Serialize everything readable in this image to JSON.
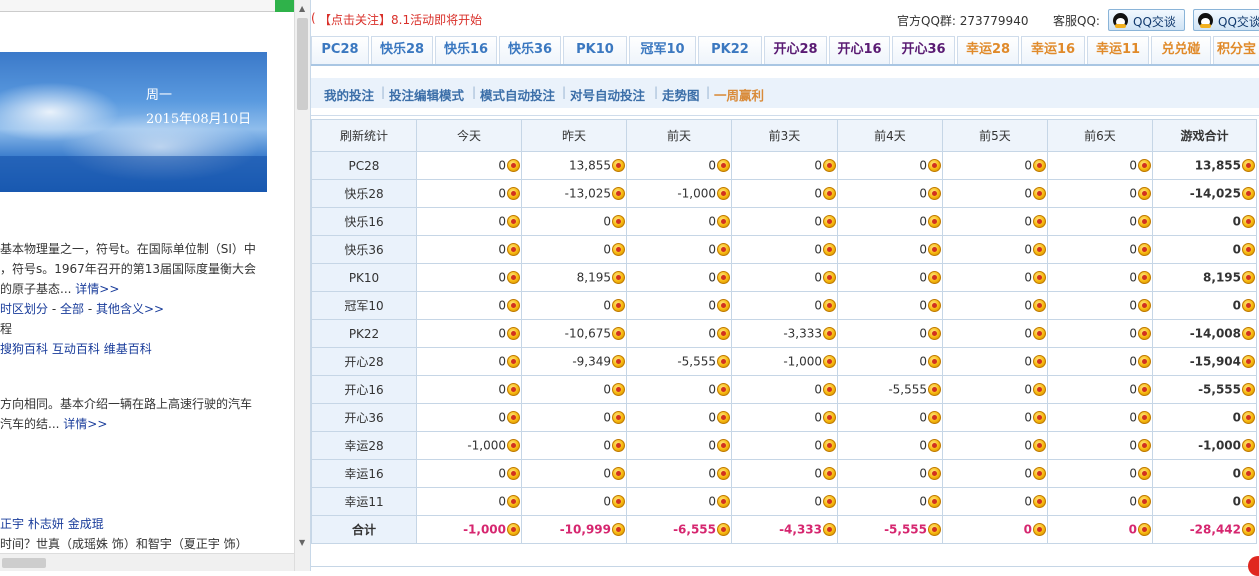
{
  "left_pane": {
    "weekday": "周一",
    "date": "2015年08月10日",
    "lines": [
      {
        "parts": [
          {
            "t": "基本物理量之一，符号t。在国际单位制（SI）中",
            "c": ""
          }
        ]
      },
      {
        "parts": [
          {
            "t": "，符号s。1967年召开的第13届国际度量衡大会",
            "c": ""
          }
        ]
      },
      {
        "parts": [
          {
            "t": "的原子基态...",
            "c": ""
          },
          {
            "t": " 详情>>",
            "c": "lnk"
          }
        ]
      },
      {
        "parts": [
          {
            "t": "时区划分",
            "c": "lnk"
          },
          {
            "t": " - ",
            "c": ""
          },
          {
            "t": "全部",
            "c": "lnk"
          },
          {
            "t": " - ",
            "c": ""
          },
          {
            "t": "其他含义>>",
            "c": "lnk"
          }
        ]
      },
      {
        "parts": [
          {
            "t": "程",
            "c": ""
          }
        ]
      },
      {
        "parts": [
          {
            "t": "搜狗百科",
            "c": "lnk"
          },
          {
            "t": "    ",
            "c": ""
          },
          {
            "t": "互动百科",
            "c": "lnk"
          },
          {
            "t": "    ",
            "c": ""
          },
          {
            "t": "维基百科",
            "c": "lnk"
          }
        ]
      },
      {
        "parts": [
          {
            "t": "方向相同。基本介绍一辆在路上高速行驶的汽车",
            "c": ""
          }
        ]
      },
      {
        "parts": [
          {
            "t": "汽车的结...",
            "c": ""
          },
          {
            "t": " 详情>>",
            "c": "lnk"
          }
        ]
      },
      {
        "parts": [
          {
            "t": "正宇",
            "c": "lnk"
          },
          {
            "t": "    ",
            "c": ""
          },
          {
            "t": "朴志妍",
            "c": "lnk"
          },
          {
            "t": "    ",
            "c": ""
          },
          {
            "t": "金成琨",
            "c": "lnk"
          }
        ]
      },
      {
        "parts": [
          {
            "t": "时间？世真（成瑶姝 饰）和智宇（夏正宇 饰）",
            "c": ""
          }
        ]
      }
    ]
  },
  "topbar": {
    "paren": "(",
    "follow": "【点击关注】",
    "event": "8.1活动即将开始",
    "qq_group_label": "官方QQ群: 273779940",
    "service_label": "客服QQ:",
    "qq_buttons": [
      "QQ交谈",
      "QQ交谈"
    ]
  },
  "tabs": [
    {
      "label": "PC28",
      "color": "#3b78c0"
    },
    {
      "label": "快乐28",
      "color": "#3b78c0"
    },
    {
      "label": "快乐16",
      "color": "#3b78c0"
    },
    {
      "label": "快乐36",
      "color": "#3b78c0"
    },
    {
      "label": "PK10",
      "color": "#3b78c0"
    },
    {
      "label": "冠军10",
      "color": "#3b78c0"
    },
    {
      "label": "PK22",
      "color": "#3b78c0"
    },
    {
      "label": "开心28",
      "color": "#5a1b73"
    },
    {
      "label": "开心16",
      "color": "#5a1b73"
    },
    {
      "label": "开心36",
      "color": "#5a1b73"
    },
    {
      "label": "幸运28",
      "color": "#e08a2a"
    },
    {
      "label": "幸运16",
      "color": "#e08a2a"
    },
    {
      "label": "幸运11",
      "color": "#e08a2a"
    },
    {
      "label": "兑兑碰",
      "color": "#e08a2a"
    },
    {
      "label": "积分宝",
      "color": "#e08a2a"
    }
  ],
  "subnav": [
    {
      "label": "我的投注",
      "active": false
    },
    {
      "label": "投注编辑模式",
      "active": false
    },
    {
      "label": "模式自动投注",
      "active": false
    },
    {
      "label": "对号自动投注",
      "active": false
    },
    {
      "label": "走势图",
      "active": false
    },
    {
      "label": "一周赢利",
      "active": true
    }
  ],
  "table": {
    "headers": [
      "刷新统计",
      "今天",
      "昨天",
      "前天",
      "前3天",
      "前4天",
      "前5天",
      "前6天",
      "游戏合计"
    ],
    "rows": [
      {
        "label": "PC28",
        "values": [
          "0",
          "13,855",
          "0",
          "0",
          "0",
          "0",
          "0",
          "13,855"
        ]
      },
      {
        "label": "快乐28",
        "values": [
          "0",
          "-13,025",
          "-1,000",
          "0",
          "0",
          "0",
          "0",
          "-14,025"
        ]
      },
      {
        "label": "快乐16",
        "values": [
          "0",
          "0",
          "0",
          "0",
          "0",
          "0",
          "0",
          "0"
        ]
      },
      {
        "label": "快乐36",
        "values": [
          "0",
          "0",
          "0",
          "0",
          "0",
          "0",
          "0",
          "0"
        ]
      },
      {
        "label": "PK10",
        "values": [
          "0",
          "8,195",
          "0",
          "0",
          "0",
          "0",
          "0",
          "8,195"
        ]
      },
      {
        "label": "冠军10",
        "values": [
          "0",
          "0",
          "0",
          "0",
          "0",
          "0",
          "0",
          "0"
        ]
      },
      {
        "label": "PK22",
        "values": [
          "0",
          "-10,675",
          "0",
          "-3,333",
          "0",
          "0",
          "0",
          "-14,008"
        ]
      },
      {
        "label": "开心28",
        "values": [
          "0",
          "-9,349",
          "-5,555",
          "-1,000",
          "0",
          "0",
          "0",
          "-15,904"
        ]
      },
      {
        "label": "开心16",
        "values": [
          "0",
          "0",
          "0",
          "0",
          "-5,555",
          "0",
          "0",
          "-5,555"
        ]
      },
      {
        "label": "开心36",
        "values": [
          "0",
          "0",
          "0",
          "0",
          "0",
          "0",
          "0",
          "0"
        ]
      },
      {
        "label": "幸运28",
        "values": [
          "-1,000",
          "0",
          "0",
          "0",
          "0",
          "0",
          "0",
          "-1,000"
        ]
      },
      {
        "label": "幸运16",
        "values": [
          "0",
          "0",
          "0",
          "0",
          "0",
          "0",
          "0",
          "0"
        ]
      },
      {
        "label": "幸运11",
        "values": [
          "0",
          "0",
          "0",
          "0",
          "0",
          "0",
          "0",
          "0"
        ]
      }
    ],
    "total": {
      "label": "合计",
      "values": [
        "-1,000",
        "-10,999",
        "-6,555",
        "-4,333",
        "-5,555",
        "0",
        "0",
        "-28,442"
      ]
    }
  }
}
